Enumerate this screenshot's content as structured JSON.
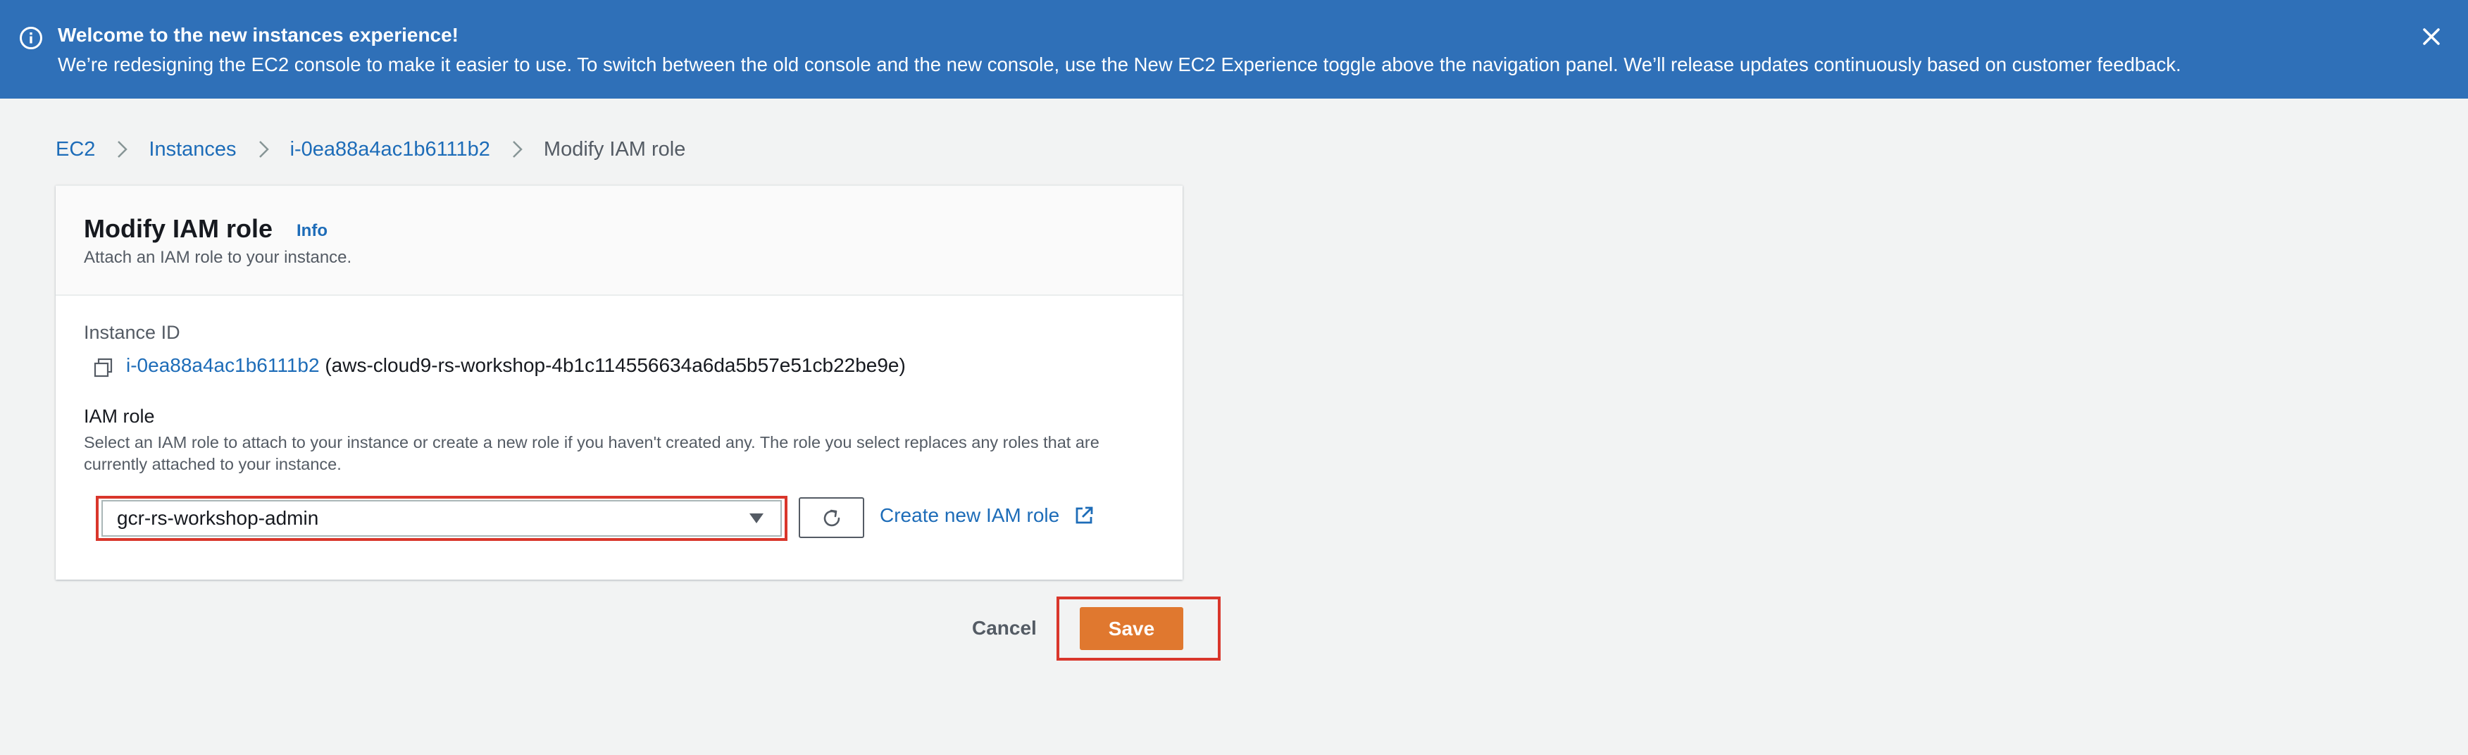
{
  "banner": {
    "title": "Welcome to the new instances experience!",
    "message": "We’re redesigning the EC2 console to make it easier to use. To switch between the old console and the new console, use the New EC2 Experience toggle above the navigation panel. We’ll release updates continuously based on customer feedback.",
    "icon": "info-icon",
    "close_icon": "close-icon",
    "background_color": "#2f70b8"
  },
  "breadcrumb": {
    "items": [
      {
        "label": "EC2"
      },
      {
        "label": "Instances"
      },
      {
        "label": "i-0ea88a4ac1b6111b2"
      },
      {
        "label": "Modify IAM role"
      }
    ]
  },
  "panel": {
    "title": "Modify IAM role",
    "info_link": "Info",
    "subtitle": "Attach an IAM role to your instance.",
    "instance_id_label": "Instance ID",
    "instance_id": "i-0ea88a4ac1b6111b2",
    "instance_name": "(aws-cloud9-rs-workshop-4b1c114556634a6da5b57e51cb22be9e)",
    "iam_role_label": "IAM role",
    "iam_role_description": "Select an IAM role to attach to your instance or create a new role if you haven't created any. The role you select replaces any roles that are currently attached to your instance.",
    "selected_role": "gcr-rs-workshop-admin",
    "create_role_link": "Create new IAM role"
  },
  "actions": {
    "cancel_label": "Cancel",
    "save_label": "Save",
    "save_color": "#e0782f"
  }
}
